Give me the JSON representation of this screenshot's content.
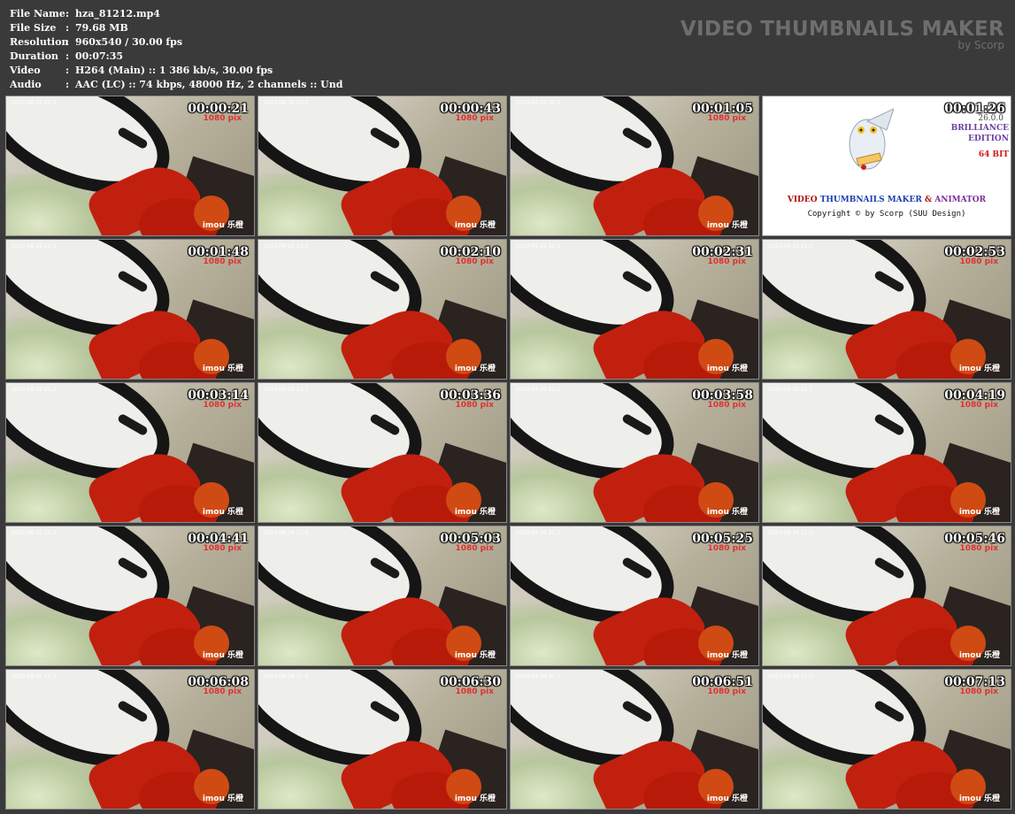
{
  "info": [
    {
      "key": "File Name",
      "value": "hza_81212.mp4"
    },
    {
      "key": "File Size",
      "value": "79.68 MB"
    },
    {
      "key": "Resolution",
      "value": "960x540 / 30.00 fps"
    },
    {
      "key": "Duration",
      "value": "00:07:35"
    },
    {
      "key": "Video",
      "value": "H264 (Main) :: 1 386 kb/s, 30.00 fps"
    },
    {
      "key": "Audio",
      "value": "AAC (LC) :: 74 kbps, 48000 Hz, 2 channels :: Und"
    }
  ],
  "separator": ":",
  "brand": {
    "title": "VIDEO THUMBNAILS MAKER",
    "subtitle": "by Scorp"
  },
  "stamp_text": "2023-08-29 21:3",
  "pix_text": "1080 pix",
  "logo_text": "imou 乐橙",
  "thumbs": [
    {
      "time": "00:00:21"
    },
    {
      "time": "00:00:43"
    },
    {
      "time": "00:01:05"
    },
    {
      "time": "00:01:26",
      "promo": true
    },
    {
      "time": "00:01:48"
    },
    {
      "time": "00:02:10"
    },
    {
      "time": "00:02:31"
    },
    {
      "time": "00:02:53"
    },
    {
      "time": "00:03:14"
    },
    {
      "time": "00:03:36"
    },
    {
      "time": "00:03:58"
    },
    {
      "time": "00:04:19"
    },
    {
      "time": "00:04:41"
    },
    {
      "time": "00:05:03"
    },
    {
      "time": "00:05:25"
    },
    {
      "time": "00:05:46"
    },
    {
      "time": "00:06:08"
    },
    {
      "time": "00:06:30"
    },
    {
      "time": "00:06:51"
    },
    {
      "time": "00:07:13"
    }
  ],
  "promo": {
    "version": "26.0.0",
    "edition_lines": [
      "BRILLIANCE",
      "EDITION"
    ],
    "bits": "64 BIT",
    "title_a": "VIDEO",
    "title_b": "THUMBNAILS MAKER",
    "title_amp": "&",
    "title_c": "ANIMATOR",
    "copyright": "Copyright © by Scorp (SUU Design)"
  },
  "colors": {
    "background": "#3a3a3a",
    "text": "#ffffff",
    "brand": "#6e6e6e",
    "red_chair": "#c2200e"
  }
}
